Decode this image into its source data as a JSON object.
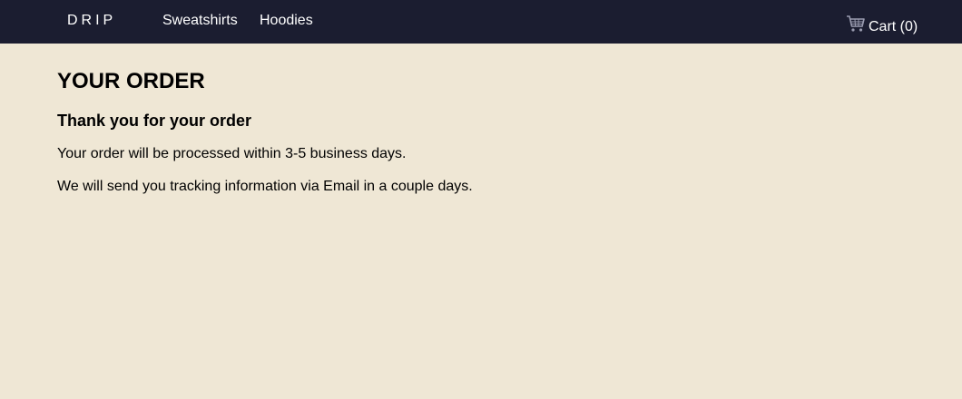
{
  "navbar": {
    "brand": "DRIP",
    "links": [
      {
        "label": "Sweatshirts"
      },
      {
        "label": "Hoodies"
      }
    ],
    "cart_label": "Cart (0)",
    "cart_icon": "shopping-cart-icon"
  },
  "main": {
    "title": "YOUR ORDER",
    "subtitle": "Thank you for your order",
    "paragraphs": [
      "Your order will be processed within 3-5 business days.",
      "We will send you tracking information via Email in a couple days."
    ]
  },
  "colors": {
    "navbar_bg": "#1b1d30",
    "page_bg": "#efe7d5",
    "nav_text": "#ffffff"
  }
}
